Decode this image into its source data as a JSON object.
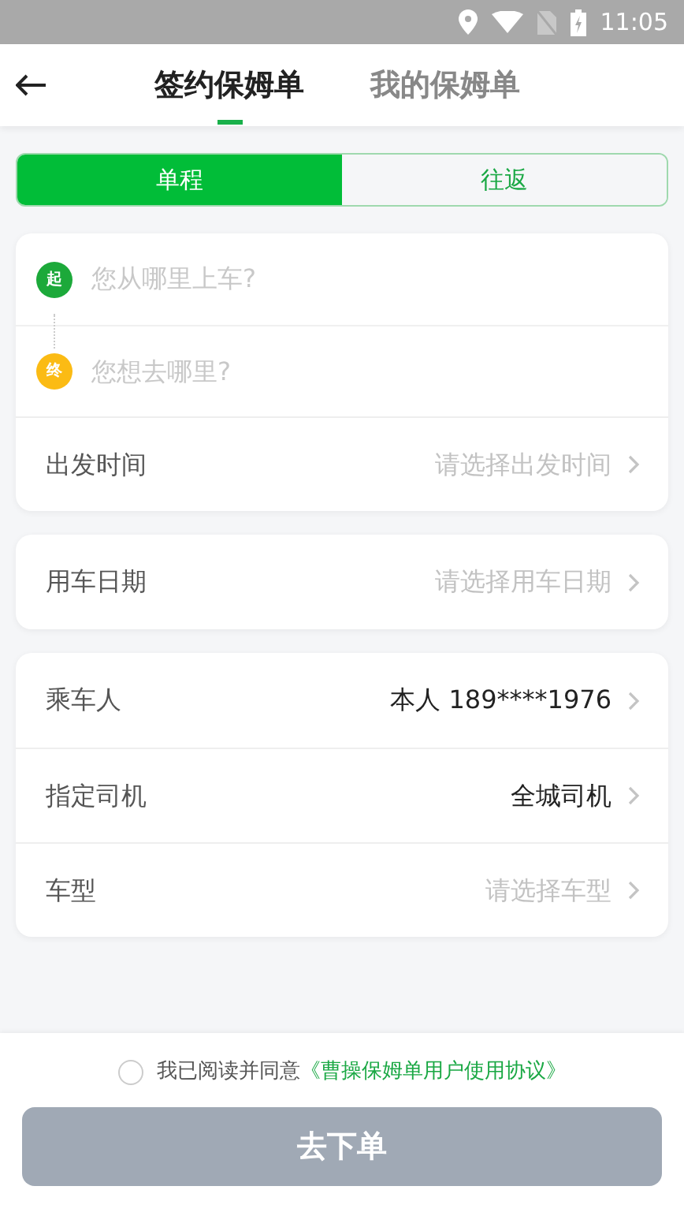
{
  "status_bar": {
    "time": "11:05"
  },
  "tabs": [
    {
      "label": "签约保姆单",
      "selected": true
    },
    {
      "label": "我的保姆单",
      "selected": false
    }
  ],
  "trip_type": [
    {
      "label": "单程",
      "selected": true
    },
    {
      "label": "往返",
      "selected": false
    }
  ],
  "route": {
    "start_badge": "起",
    "start_placeholder": "您从哪里上车?",
    "end_badge": "终",
    "end_placeholder": "您想去哪里?"
  },
  "cards": [
    [
      {
        "label": "出发时间",
        "placeholder": "请选择出发时间"
      }
    ],
    [
      {
        "label": "用车日期",
        "placeholder": "请选择用车日期"
      }
    ],
    [
      {
        "label": "乘车人",
        "value": "本人 189****1976"
      },
      {
        "label": "指定司机",
        "value": "全城司机"
      },
      {
        "label": "车型",
        "placeholder": "请选择车型"
      }
    ]
  ],
  "agreement": {
    "checked": false,
    "text": "我已阅读并同意",
    "link": "《曹操保姆单用户使用协议》"
  },
  "submit": {
    "label": "去下单",
    "disabled": true
  }
}
